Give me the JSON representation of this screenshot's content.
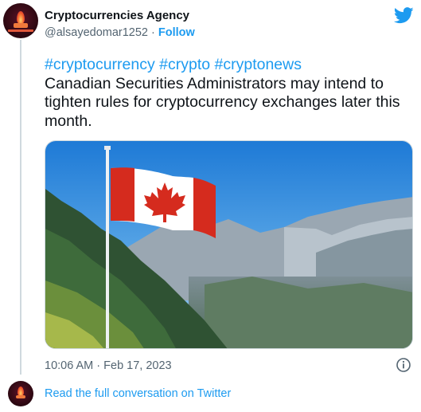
{
  "author": {
    "name": "Cryptocurrencies Agency",
    "handle": "@alsayedomar1252",
    "separator": "·",
    "follow_label": "Follow"
  },
  "tweet": {
    "hashtags": [
      "#cryptocurrency",
      "#crypto",
      "#cryptonews"
    ],
    "body": "Canadian Securities Administrators may intend to tighten rules for cryptocurrency exchanges later this month.",
    "timestamp": "10:06 AM · Feb 17, 2023",
    "image_icon": "photo-canadian-flag-mountains"
  },
  "footer": {
    "read_more_label": "Read the full conversation on Twitter"
  },
  "colors": {
    "accent": "#1d9bf0",
    "text": "#0f1419",
    "muted": "#536471",
    "border": "#cfd9de"
  },
  "icons": {
    "brand": "twitter-bird-icon",
    "info": "info-icon"
  }
}
